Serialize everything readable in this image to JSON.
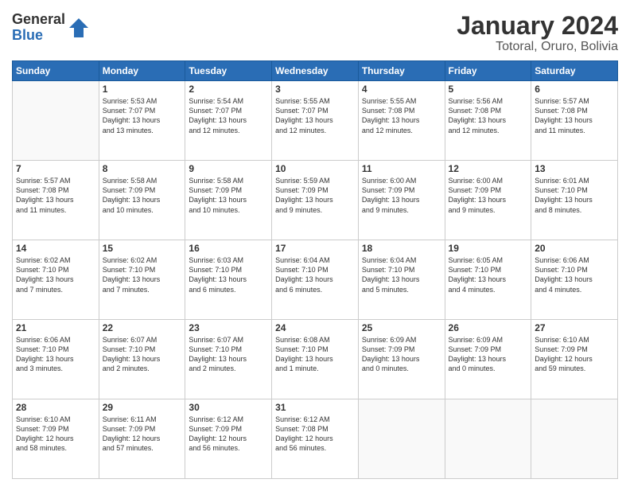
{
  "logo": {
    "general": "General",
    "blue": "Blue"
  },
  "title": "January 2024",
  "location": "Totoral, Oruro, Bolivia",
  "days": [
    "Sunday",
    "Monday",
    "Tuesday",
    "Wednesday",
    "Thursday",
    "Friday",
    "Saturday"
  ],
  "weeks": [
    [
      {
        "day": "",
        "content": ""
      },
      {
        "day": "1",
        "content": "Sunrise: 5:53 AM\nSunset: 7:07 PM\nDaylight: 13 hours\nand 13 minutes."
      },
      {
        "day": "2",
        "content": "Sunrise: 5:54 AM\nSunset: 7:07 PM\nDaylight: 13 hours\nand 12 minutes."
      },
      {
        "day": "3",
        "content": "Sunrise: 5:55 AM\nSunset: 7:07 PM\nDaylight: 13 hours\nand 12 minutes."
      },
      {
        "day": "4",
        "content": "Sunrise: 5:55 AM\nSunset: 7:08 PM\nDaylight: 13 hours\nand 12 minutes."
      },
      {
        "day": "5",
        "content": "Sunrise: 5:56 AM\nSunset: 7:08 PM\nDaylight: 13 hours\nand 12 minutes."
      },
      {
        "day": "6",
        "content": "Sunrise: 5:57 AM\nSunset: 7:08 PM\nDaylight: 13 hours\nand 11 minutes."
      }
    ],
    [
      {
        "day": "7",
        "content": "Sunrise: 5:57 AM\nSunset: 7:08 PM\nDaylight: 13 hours\nand 11 minutes."
      },
      {
        "day": "8",
        "content": "Sunrise: 5:58 AM\nSunset: 7:09 PM\nDaylight: 13 hours\nand 10 minutes."
      },
      {
        "day": "9",
        "content": "Sunrise: 5:58 AM\nSunset: 7:09 PM\nDaylight: 13 hours\nand 10 minutes."
      },
      {
        "day": "10",
        "content": "Sunrise: 5:59 AM\nSunset: 7:09 PM\nDaylight: 13 hours\nand 9 minutes."
      },
      {
        "day": "11",
        "content": "Sunrise: 6:00 AM\nSunset: 7:09 PM\nDaylight: 13 hours\nand 9 minutes."
      },
      {
        "day": "12",
        "content": "Sunrise: 6:00 AM\nSunset: 7:09 PM\nDaylight: 13 hours\nand 9 minutes."
      },
      {
        "day": "13",
        "content": "Sunrise: 6:01 AM\nSunset: 7:10 PM\nDaylight: 13 hours\nand 8 minutes."
      }
    ],
    [
      {
        "day": "14",
        "content": "Sunrise: 6:02 AM\nSunset: 7:10 PM\nDaylight: 13 hours\nand 7 minutes."
      },
      {
        "day": "15",
        "content": "Sunrise: 6:02 AM\nSunset: 7:10 PM\nDaylight: 13 hours\nand 7 minutes."
      },
      {
        "day": "16",
        "content": "Sunrise: 6:03 AM\nSunset: 7:10 PM\nDaylight: 13 hours\nand 6 minutes."
      },
      {
        "day": "17",
        "content": "Sunrise: 6:04 AM\nSunset: 7:10 PM\nDaylight: 13 hours\nand 6 minutes."
      },
      {
        "day": "18",
        "content": "Sunrise: 6:04 AM\nSunset: 7:10 PM\nDaylight: 13 hours\nand 5 minutes."
      },
      {
        "day": "19",
        "content": "Sunrise: 6:05 AM\nSunset: 7:10 PM\nDaylight: 13 hours\nand 4 minutes."
      },
      {
        "day": "20",
        "content": "Sunrise: 6:06 AM\nSunset: 7:10 PM\nDaylight: 13 hours\nand 4 minutes."
      }
    ],
    [
      {
        "day": "21",
        "content": "Sunrise: 6:06 AM\nSunset: 7:10 PM\nDaylight: 13 hours\nand 3 minutes."
      },
      {
        "day": "22",
        "content": "Sunrise: 6:07 AM\nSunset: 7:10 PM\nDaylight: 13 hours\nand 2 minutes."
      },
      {
        "day": "23",
        "content": "Sunrise: 6:07 AM\nSunset: 7:10 PM\nDaylight: 13 hours\nand 2 minutes."
      },
      {
        "day": "24",
        "content": "Sunrise: 6:08 AM\nSunset: 7:10 PM\nDaylight: 13 hours\nand 1 minute."
      },
      {
        "day": "25",
        "content": "Sunrise: 6:09 AM\nSunset: 7:09 PM\nDaylight: 13 hours\nand 0 minutes."
      },
      {
        "day": "26",
        "content": "Sunrise: 6:09 AM\nSunset: 7:09 PM\nDaylight: 13 hours\nand 0 minutes."
      },
      {
        "day": "27",
        "content": "Sunrise: 6:10 AM\nSunset: 7:09 PM\nDaylight: 12 hours\nand 59 minutes."
      }
    ],
    [
      {
        "day": "28",
        "content": "Sunrise: 6:10 AM\nSunset: 7:09 PM\nDaylight: 12 hours\nand 58 minutes."
      },
      {
        "day": "29",
        "content": "Sunrise: 6:11 AM\nSunset: 7:09 PM\nDaylight: 12 hours\nand 57 minutes."
      },
      {
        "day": "30",
        "content": "Sunrise: 6:12 AM\nSunset: 7:09 PM\nDaylight: 12 hours\nand 56 minutes."
      },
      {
        "day": "31",
        "content": "Sunrise: 6:12 AM\nSunset: 7:08 PM\nDaylight: 12 hours\nand 56 minutes."
      },
      {
        "day": "",
        "content": ""
      },
      {
        "day": "",
        "content": ""
      },
      {
        "day": "",
        "content": ""
      }
    ]
  ]
}
